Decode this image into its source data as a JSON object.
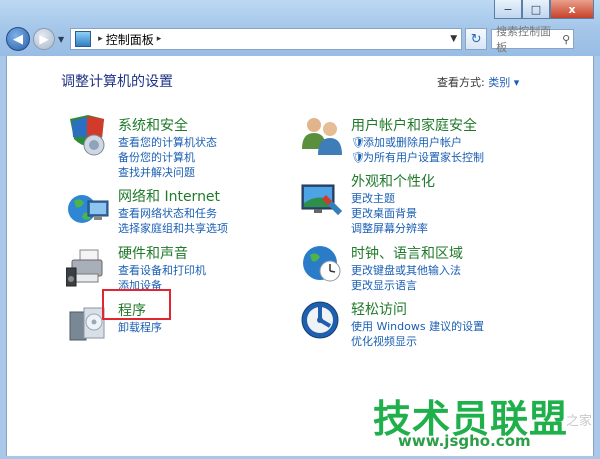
{
  "window": {
    "min_label": "−",
    "max_label": "□",
    "close_label": "x"
  },
  "nav": {
    "address_root": "控制面板",
    "search_placeholder": "搜索控制面板"
  },
  "page": {
    "title": "调整计算机的设置",
    "view_by_label": "查看方式:",
    "view_by_value": "类别 ▾"
  },
  "categories": [
    {
      "head": "系统和安全",
      "links": [
        "查看您的计算机状态",
        "备份您的计算机",
        "查找并解决问题"
      ]
    },
    {
      "head": "网络和 Internet",
      "links": [
        "查看网络状态和任务",
        "选择家庭组和共享选项"
      ]
    },
    {
      "head": "硬件和声音",
      "links": [
        "查看设备和打印机",
        "添加设备"
      ]
    },
    {
      "head": "程序",
      "links": [
        "卸载程序"
      ]
    },
    {
      "head": "用户帐户和家庭安全",
      "links": [
        "添加或删除用户帐户",
        "为所有用户设置家长控制"
      ]
    },
    {
      "head": "外观和个性化",
      "links": [
        "更改主题",
        "更改桌面背景",
        "调整屏幕分辨率"
      ]
    },
    {
      "head": "时钟、语言和区域",
      "links": [
        "更改键盘或其他输入法",
        "更改显示语言"
      ]
    },
    {
      "head": "轻松访问",
      "links": [
        "使用 Windows 建议的设置",
        "优化视频显示"
      ]
    }
  ],
  "watermark": {
    "main": "技术员联盟",
    "url": "www.jsgho.com",
    "side": "之家"
  }
}
